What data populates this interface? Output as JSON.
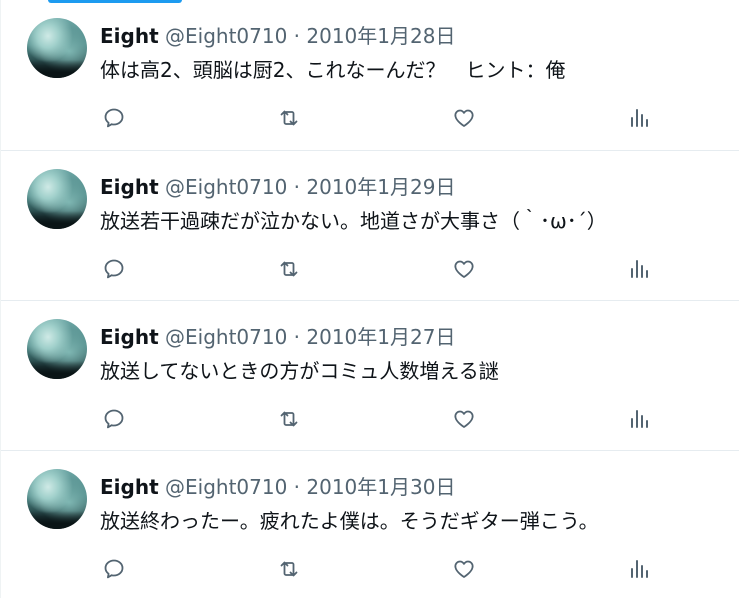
{
  "tweets": [
    {
      "name": "Eight",
      "meta": "@Eight0710 · 2010年1月28日",
      "text": "体は高2、頭脳は厨2、これなーんだ？　ヒント：俺"
    },
    {
      "name": "Eight",
      "meta": "@Eight0710 · 2010年1月29日",
      "text": "放送若干過疎だが泣かない。地道さが大事さ（｀･ω･´）"
    },
    {
      "name": "Eight",
      "meta": "@Eight0710 · 2010年1月27日",
      "text": "放送してないときの方がコミュ人数増える謎"
    },
    {
      "name": "Eight",
      "meta": "@Eight0710 · 2010年1月30日",
      "text": "放送終わったー。疲れたよ僕は。そうだギター弾こう。"
    }
  ],
  "icons": {
    "reply": "reply-icon",
    "retweet": "retweet-icon",
    "like": "like-icon",
    "stats": "stats-icon"
  },
  "colors": {
    "accent": "#1d9bf0",
    "text": "#0f1419",
    "secondary": "#536471",
    "divider": "#e6ecf0"
  }
}
